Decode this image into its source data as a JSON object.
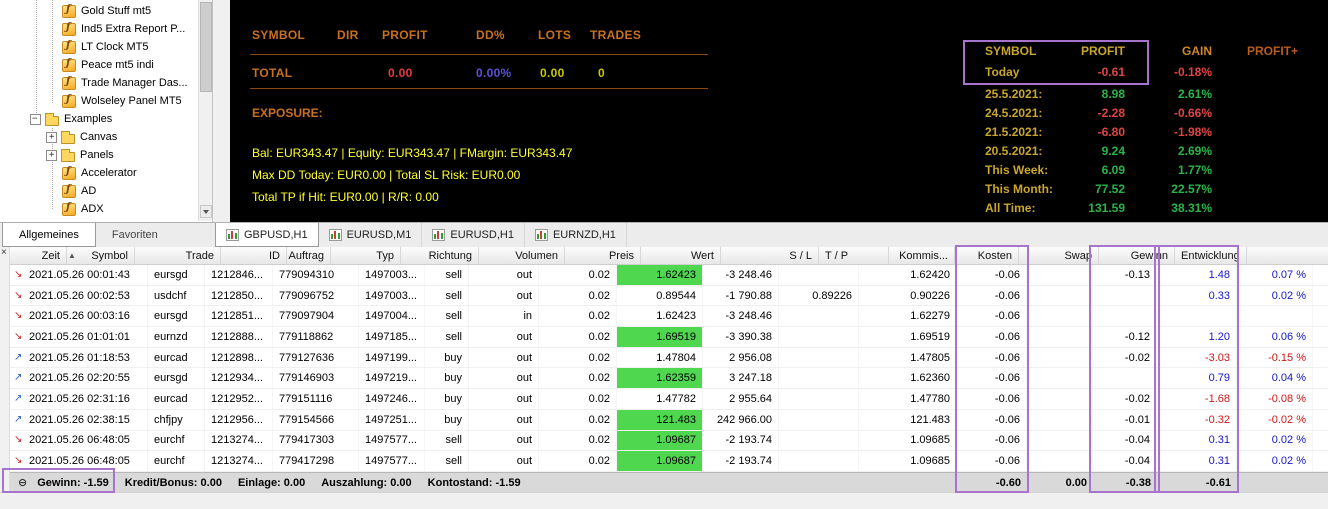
{
  "navigator": {
    "items": [
      {
        "label": "Gold Stuff mt5",
        "type": "ind",
        "level": "lv2",
        "expander": ""
      },
      {
        "label": "Ind5 Extra Report P...",
        "type": "ind",
        "level": "lv2",
        "expander": ""
      },
      {
        "label": "LT Clock MT5",
        "type": "ind",
        "level": "lv2",
        "expander": ""
      },
      {
        "label": "Peace mt5 indi",
        "type": "ind",
        "level": "lv2",
        "expander": ""
      },
      {
        "label": "Trade Manager Das...",
        "type": "ind",
        "level": "lv2",
        "expander": ""
      },
      {
        "label": "Wolseley Panel MT5",
        "type": "ind",
        "level": "lv2",
        "expander": ""
      },
      {
        "label": "Examples",
        "type": "folder-open",
        "level": "lv1",
        "expander": "minus"
      },
      {
        "label": "Canvas",
        "type": "folder",
        "level": "lv2",
        "expander": "plus"
      },
      {
        "label": "Panels",
        "type": "folder",
        "level": "lv2",
        "expander": "plus"
      },
      {
        "label": "Accelerator",
        "type": "ind",
        "level": "lv2",
        "expander": ""
      },
      {
        "label": "AD",
        "type": "ind",
        "level": "lv2",
        "expander": ""
      },
      {
        "label": "ADX",
        "type": "ind",
        "level": "lv2",
        "expander": ""
      }
    ],
    "tabs": [
      {
        "label": "Allgemeines",
        "active": true
      },
      {
        "label": "Favoriten",
        "active": false
      }
    ]
  },
  "chart": {
    "panel": {
      "headers": [
        "SYMBOL",
        "DIR",
        "PROFIT",
        "DD%",
        "LOTS",
        "TRADES"
      ],
      "total_label": "TOTAL",
      "total_profit": "0.00",
      "total_dd": "0.00%",
      "total_lots": "0.00",
      "total_trades": "0",
      "exposure_label": "EXPOSURE:",
      "info_lines": [
        "Bal: EUR343.47 | Equity: EUR343.47 | FMargin: EUR343.47",
        "Max DD Today: EUR0.00 | Total SL Risk: EUR0.00",
        "Total TP if Hit: EUR0.00 | R/R: 0.00"
      ]
    },
    "stats": {
      "headers": [
        "SYMBOL",
        "PROFIT",
        "GAIN",
        "PROFIT+"
      ],
      "rows": [
        {
          "label": "Today",
          "profit": "-0.61",
          "gain": "-0.18%"
        },
        {
          "label": "25.5.2021:",
          "profit": "8.98",
          "gain": "2.61%"
        },
        {
          "label": "24.5.2021:",
          "profit": "-2.28",
          "gain": "-0.66%"
        },
        {
          "label": "21.5.2021:",
          "profit": "-6.80",
          "gain": "-1.98%"
        },
        {
          "label": "20.5.2021:",
          "profit": "9.24",
          "gain": "2.69%"
        },
        {
          "label": "This Week:",
          "profit": "6.09",
          "gain": "1.77%"
        },
        {
          "label": "This Month:",
          "profit": "77.52",
          "gain": "22.57%"
        },
        {
          "label": "All Time:",
          "profit": "131.59",
          "gain": "38.31%"
        }
      ]
    },
    "tabs": [
      {
        "label": "GBPUSD,H1",
        "active": true
      },
      {
        "label": "EURUSD,M1",
        "active": false
      },
      {
        "label": "EURUSD,H1",
        "active": false
      },
      {
        "label": "EURNZD,H1",
        "active": false
      }
    ]
  },
  "table": {
    "close_icon": "×",
    "sort_icon": "▲",
    "columns": [
      "Zeit",
      "Symbol",
      "Trade",
      "ID",
      "Auftrag",
      "Typ",
      "Richtung",
      "Volumen",
      "Preis",
      "Wert",
      "S / L",
      "T / P",
      "Kommis...",
      "Kosten",
      "Swap",
      "Gewinn",
      "Entwicklung"
    ],
    "rows": [
      {
        "time": "2021.05.26 00:01:43",
        "symbol": "eursgd",
        "trade": "1212846...",
        "id": "779094310",
        "auftrag": "1497003...",
        "typ": "sell",
        "richtung": "out",
        "volumen": "0.02",
        "preis": "1.62423",
        "preis_hl": true,
        "wert": "-3 248.46",
        "sl": "",
        "tp": "1.62420",
        "kommis": "-0.06",
        "kosten": "",
        "swap": "-0.13",
        "gewinn": "1.48",
        "entw": "0.07 %",
        "icon": "red"
      },
      {
        "time": "2021.05.26 00:02:53",
        "symbol": "usdchf",
        "trade": "1212850...",
        "id": "779096752",
        "auftrag": "1497003...",
        "typ": "sell",
        "richtung": "out",
        "volumen": "0.02",
        "preis": "0.89544",
        "preis_hl": false,
        "wert": "-1 790.88",
        "sl": "0.89226",
        "tp": "0.90226",
        "kommis": "-0.06",
        "kosten": "",
        "swap": "",
        "gewinn": "0.33",
        "entw": "0.02 %",
        "icon": "red"
      },
      {
        "time": "2021.05.26 00:03:16",
        "symbol": "eursgd",
        "trade": "1212851...",
        "id": "779097904",
        "auftrag": "1497004...",
        "typ": "sell",
        "richtung": "in",
        "volumen": "0.02",
        "preis": "1.62423",
        "preis_hl": false,
        "wert": "-3 248.46",
        "sl": "",
        "tp": "1.62279",
        "kommis": "-0.06",
        "kosten": "",
        "swap": "",
        "gewinn": "",
        "entw": "",
        "icon": "red"
      },
      {
        "time": "2021.05.26 01:01:01",
        "symbol": "eurnzd",
        "trade": "1212888...",
        "id": "779118862",
        "auftrag": "1497185...",
        "typ": "sell",
        "richtung": "out",
        "volumen": "0.02",
        "preis": "1.69519",
        "preis_hl": true,
        "wert": "-3 390.38",
        "sl": "",
        "tp": "1.69519",
        "kommis": "-0.06",
        "kosten": "",
        "swap": "-0.12",
        "gewinn": "1.20",
        "entw": "0.06 %",
        "icon": "red"
      },
      {
        "time": "2021.05.26 01:18:53",
        "symbol": "eurcad",
        "trade": "1212898...",
        "id": "779127636",
        "auftrag": "1497199...",
        "typ": "buy",
        "richtung": "out",
        "volumen": "0.02",
        "preis": "1.47804",
        "preis_hl": false,
        "wert": "2 956.08",
        "sl": "",
        "tp": "1.47805",
        "kommis": "-0.06",
        "kosten": "",
        "swap": "-0.02",
        "gewinn": "-3.03",
        "entw": "-0.15 %",
        "icon": "blue"
      },
      {
        "time": "2021.05.26 02:20:55",
        "symbol": "eursgd",
        "trade": "1212934...",
        "id": "779146903",
        "auftrag": "1497219...",
        "typ": "buy",
        "richtung": "out",
        "volumen": "0.02",
        "preis": "1.62359",
        "preis_hl": true,
        "wert": "3 247.18",
        "sl": "",
        "tp": "1.62360",
        "kommis": "-0.06",
        "kosten": "",
        "swap": "",
        "gewinn": "0.79",
        "entw": "0.04 %",
        "icon": "blue"
      },
      {
        "time": "2021.05.26 02:31:16",
        "symbol": "eurcad",
        "trade": "1212952...",
        "id": "779151116",
        "auftrag": "1497246...",
        "typ": "buy",
        "richtung": "out",
        "volumen": "0.02",
        "preis": "1.47782",
        "preis_hl": false,
        "wert": "2 955.64",
        "sl": "",
        "tp": "1.47780",
        "kommis": "-0.06",
        "kosten": "",
        "swap": "-0.02",
        "gewinn": "-1.68",
        "entw": "-0.08 %",
        "icon": "blue"
      },
      {
        "time": "2021.05.26 02:38:15",
        "symbol": "chfjpy",
        "trade": "1212956...",
        "id": "779154566",
        "auftrag": "1497251...",
        "typ": "buy",
        "richtung": "out",
        "volumen": "0.02",
        "preis": "121.483",
        "preis_hl": true,
        "wert": "242 966.00",
        "sl": "",
        "tp": "121.483",
        "kommis": "-0.06",
        "kosten": "",
        "swap": "-0.01",
        "gewinn": "-0.32",
        "entw": "-0.02 %",
        "icon": "blue"
      },
      {
        "time": "2021.05.26 06:48:05",
        "symbol": "eurchf",
        "trade": "1213274...",
        "id": "779417303",
        "auftrag": "1497577...",
        "typ": "sell",
        "richtung": "out",
        "volumen": "0.02",
        "preis": "1.09687",
        "preis_hl": true,
        "wert": "-2 193.74",
        "sl": "",
        "tp": "1.09685",
        "kommis": "-0.06",
        "kosten": "",
        "swap": "-0.04",
        "gewinn": "0.31",
        "entw": "0.02 %",
        "icon": "red"
      },
      {
        "time": "2021.05.26 06:48:05",
        "symbol": "eurchf",
        "trade": "1213274...",
        "id": "779417298",
        "auftrag": "1497577...",
        "typ": "sell",
        "richtung": "out",
        "volumen": "0.02",
        "preis": "1.09687",
        "preis_hl": true,
        "wert": "-2 193.74",
        "sl": "",
        "tp": "1.09685",
        "kommis": "-0.06",
        "kosten": "",
        "swap": "-0.04",
        "gewinn": "0.31",
        "entw": "0.02 %",
        "icon": "red"
      }
    ],
    "footer": {
      "collapse_icon": "⊖",
      "items": [
        "Gewinn: -1.59",
        "Kredit/Bonus: 0.00",
        "Einlage: 0.00",
        "Auszahlung: 0.00",
        "Kontostand: -1.59"
      ],
      "kommis": "-0.60",
      "kosten": "0.00",
      "swap": "-0.38",
      "gewinn": "-0.61"
    }
  }
}
